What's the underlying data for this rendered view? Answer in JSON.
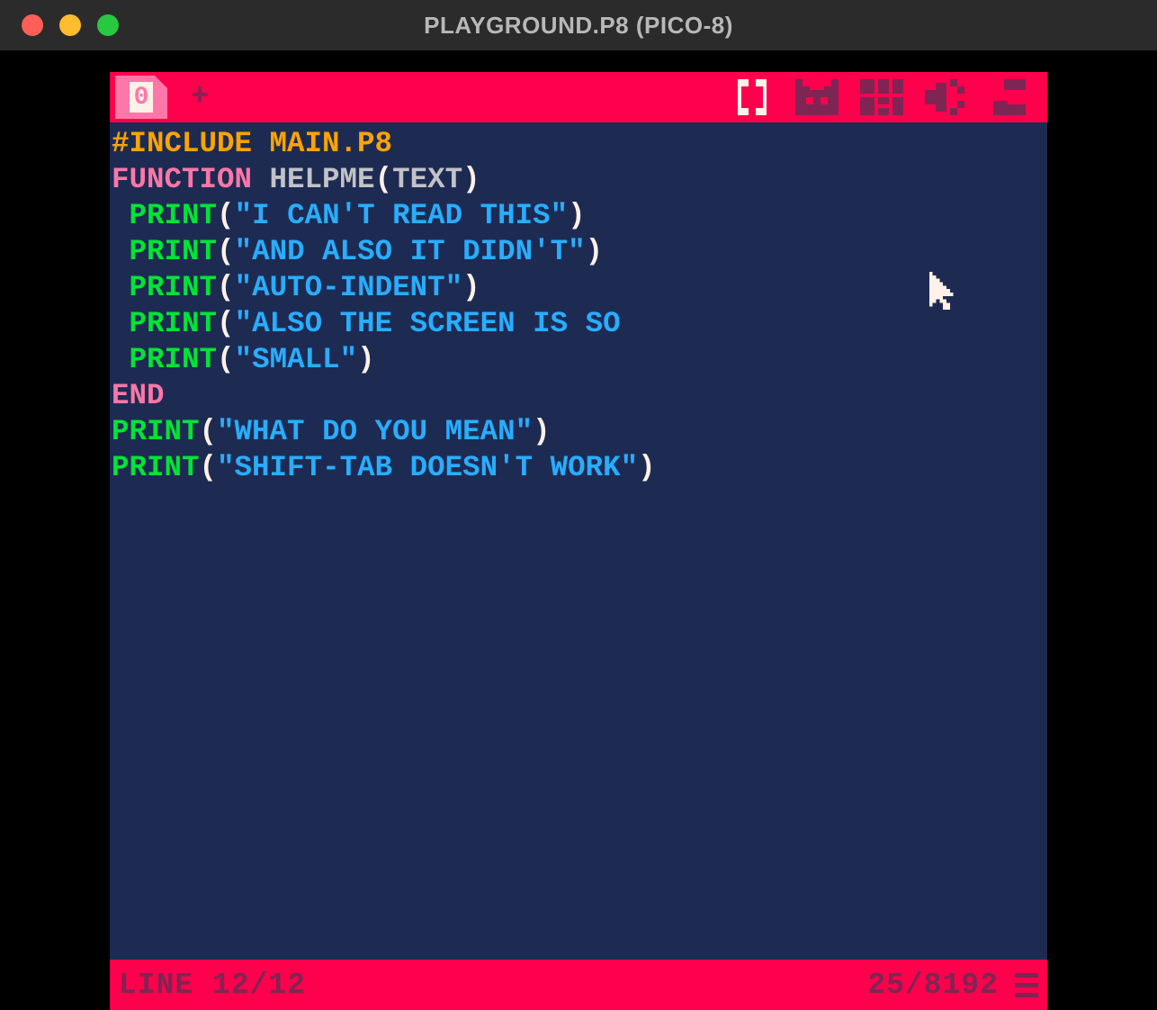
{
  "window": {
    "title": "PLAYGROUND.P8 (PICO-8)"
  },
  "toolbar": {
    "tab_number": "0",
    "add_label": "+"
  },
  "colors": {
    "pink_bg": "#ff004d",
    "dark_blue": "#1d2b53",
    "orange": "#ffa300",
    "light_pink": "#ff77a8",
    "grey": "#c2c3c7",
    "green": "#00e436",
    "white": "#fff1e8",
    "blue": "#29adff",
    "maroon": "#7e2553"
  },
  "code": {
    "lines": [
      [
        {
          "cls": "c-orange",
          "txt": "#INCLUDE MAIN.P8"
        }
      ],
      [
        {
          "cls": "",
          "txt": ""
        }
      ],
      [
        {
          "cls": "c-pink",
          "txt": "FUNCTION"
        },
        {
          "cls": "c-grey",
          "txt": " HELPME"
        },
        {
          "cls": "c-white",
          "txt": "("
        },
        {
          "cls": "c-grey",
          "txt": "TEXT"
        },
        {
          "cls": "c-white",
          "txt": ")"
        }
      ],
      [
        {
          "cls": "",
          "txt": " "
        },
        {
          "cls": "c-green",
          "txt": "PRINT"
        },
        {
          "cls": "c-white",
          "txt": "("
        },
        {
          "cls": "c-blue",
          "txt": "\"I CAN'T READ THIS\""
        },
        {
          "cls": "c-white",
          "txt": ")"
        }
      ],
      [
        {
          "cls": "",
          "txt": " "
        },
        {
          "cls": "c-green",
          "txt": "PRINT"
        },
        {
          "cls": "c-white",
          "txt": "("
        },
        {
          "cls": "c-blue",
          "txt": "\"AND ALSO IT DIDN'T\""
        },
        {
          "cls": "c-white",
          "txt": ")"
        }
      ],
      [
        {
          "cls": "",
          "txt": " "
        },
        {
          "cls": "c-green",
          "txt": "PRINT"
        },
        {
          "cls": "c-white",
          "txt": "("
        },
        {
          "cls": "c-blue",
          "txt": "\"AUTO-INDENT\""
        },
        {
          "cls": "c-white",
          "txt": ")"
        }
      ],
      [
        {
          "cls": "",
          "txt": " "
        },
        {
          "cls": "c-green",
          "txt": "PRINT"
        },
        {
          "cls": "c-white",
          "txt": "("
        },
        {
          "cls": "c-blue",
          "txt": "\"ALSO THE SCREEN IS SO"
        }
      ],
      [
        {
          "cls": "",
          "txt": " "
        },
        {
          "cls": "c-green",
          "txt": "PRINT"
        },
        {
          "cls": "c-white",
          "txt": "("
        },
        {
          "cls": "c-blue",
          "txt": "\"SMALL\""
        },
        {
          "cls": "c-white",
          "txt": ")"
        }
      ],
      [
        {
          "cls": "c-pink",
          "txt": "END"
        }
      ],
      [
        {
          "cls": "",
          "txt": ""
        }
      ],
      [
        {
          "cls": "c-green",
          "txt": "PRINT"
        },
        {
          "cls": "c-white",
          "txt": "("
        },
        {
          "cls": "c-blue",
          "txt": "\"WHAT DO YOU MEAN\""
        },
        {
          "cls": "c-white",
          "txt": ")"
        }
      ],
      [
        {
          "cls": "c-green",
          "txt": "PRINT"
        },
        {
          "cls": "c-white",
          "txt": "("
        },
        {
          "cls": "c-blue",
          "txt": "\"SHIFT-TAB DOESN'T WORK\""
        },
        {
          "cls": "c-white",
          "txt": ")"
        }
      ]
    ]
  },
  "status": {
    "line_text": "LINE 12/12",
    "token_text": "25/8192",
    "current_line": 12,
    "total_lines": 12,
    "tokens_used": 25,
    "token_limit": 8192
  },
  "editor_tabs": {
    "icons": [
      "code",
      "sprite",
      "map",
      "sfx",
      "music"
    ],
    "active": "code"
  }
}
